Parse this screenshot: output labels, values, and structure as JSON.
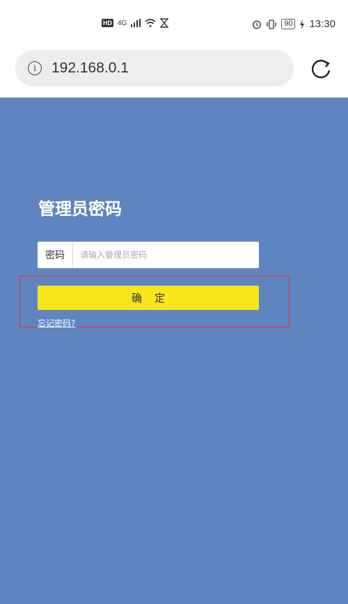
{
  "status_bar": {
    "hd": "HD",
    "network": "4G",
    "battery": "90",
    "time": "13:30"
  },
  "browser": {
    "url": "192.168.0.1"
  },
  "login": {
    "title": "管理员密码",
    "password_label": "密码",
    "password_placeholder": "请输入管理员密码",
    "confirm_label": "确定",
    "forgot_label": "忘记密码?"
  },
  "colors": {
    "page_bg": "#5f85c0",
    "button_bg": "#f7e61a",
    "highlight": "#e03030"
  }
}
